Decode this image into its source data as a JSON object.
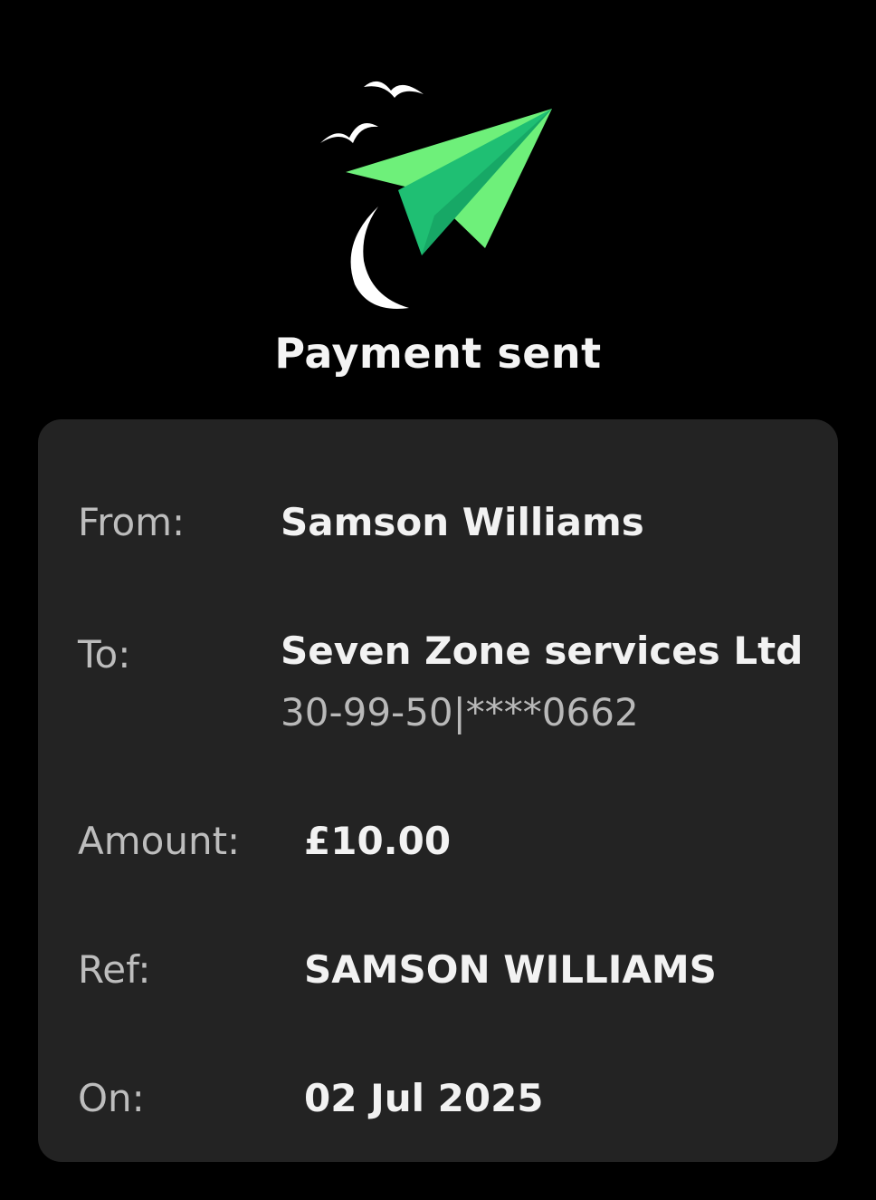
{
  "header": {
    "title": "Payment sent",
    "icon": "paper-plane-icon"
  },
  "colors": {
    "background": "#000000",
    "card": "#232323",
    "accent_green": "#6ef07a",
    "accent_green_dark": "#1fbf73",
    "label": "#bdbdbd",
    "value": "#f2f2f2"
  },
  "details": {
    "from": {
      "label": "From:",
      "value": "Samson Williams"
    },
    "to": {
      "label": "To:",
      "value": "Seven Zone services  Ltd",
      "account": "30-99-50|****0662"
    },
    "amount": {
      "label": "Amount:",
      "value": "£10.00"
    },
    "ref": {
      "label": "Ref:",
      "value": "SAMSON WILLIAMS"
    },
    "on": {
      "label": "On:",
      "value": "02 Jul 2025"
    }
  }
}
